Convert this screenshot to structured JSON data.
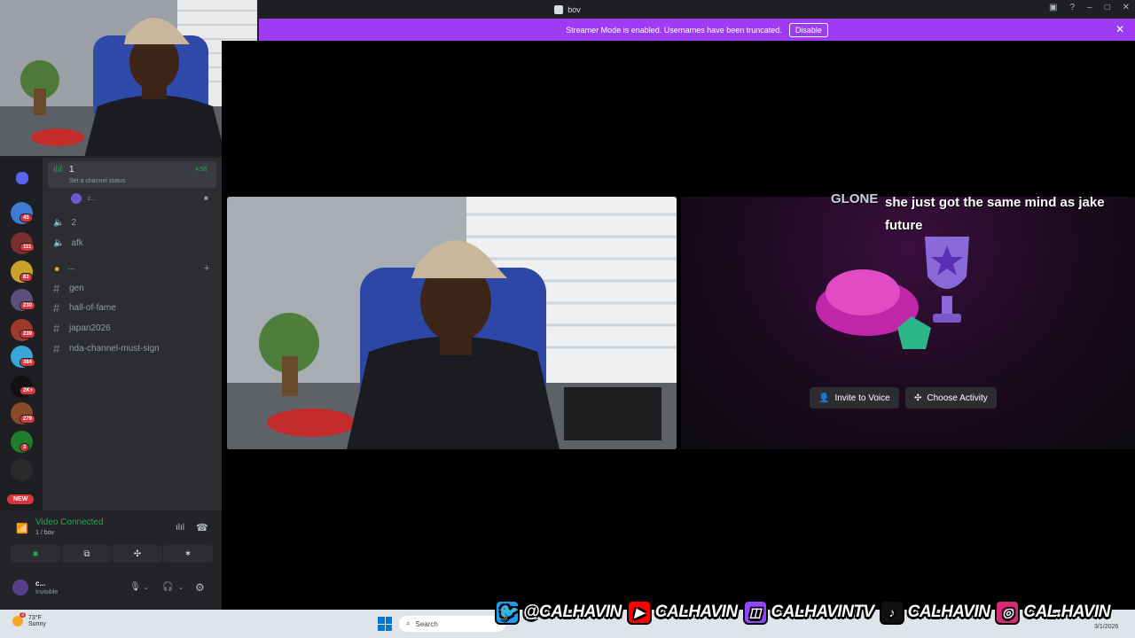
{
  "window": {
    "title": "bov"
  },
  "banner": {
    "text": "Streamer Mode is enabled. Usernames have been truncated.",
    "button": "Disable"
  },
  "server_badges": [
    "45",
    "111",
    "83",
    "230",
    "239",
    "384",
    "2K+",
    "279",
    "3"
  ],
  "new_label": "NEW",
  "channels": {
    "voice_active": {
      "name": "1",
      "time": "4:56",
      "status": "Set a channel status",
      "member": "c..."
    },
    "voice_others": [
      "2",
      "afk"
    ],
    "category": "---",
    "text": [
      "gen",
      "hall-of-fame",
      "japan2026",
      "nda-channel-must-sign"
    ]
  },
  "voice": {
    "title": "Video Connected",
    "subtitle": "1 / bov"
  },
  "user": {
    "name": "c...",
    "status": "Invisible"
  },
  "activity": {
    "invite": "Invite to Voice",
    "choose": "Choose Activity"
  },
  "chat": {
    "name": "GLONE",
    "message": "she just got the same mind as jake future"
  },
  "taskbar": {
    "temp": "73°F",
    "weather": "Sunny",
    "search": "Search",
    "date": "3/1/2026",
    "weather_badge": "2"
  },
  "socials": [
    {
      "handle": "@CALHAVIN",
      "icon": "twitter-icon",
      "color": "#1d9bf0"
    },
    {
      "handle": "CALHAVIN",
      "icon": "youtube-icon",
      "color": "#ff0000"
    },
    {
      "handle": "CALHAVINTV",
      "icon": "twitch-icon",
      "color": "#9146ff"
    },
    {
      "handle": "CALHAVIN",
      "icon": "tiktok-icon",
      "color": "#111111"
    },
    {
      "handle": "CAL.HAVIN",
      "icon": "instagram-icon",
      "color": "#d62976"
    }
  ],
  "colors": {
    "accent": "#9d3cf2",
    "connected": "#23a559",
    "badge": "#da373c",
    "sidebar": "#2b2d31",
    "rail": "#1e1f22"
  }
}
